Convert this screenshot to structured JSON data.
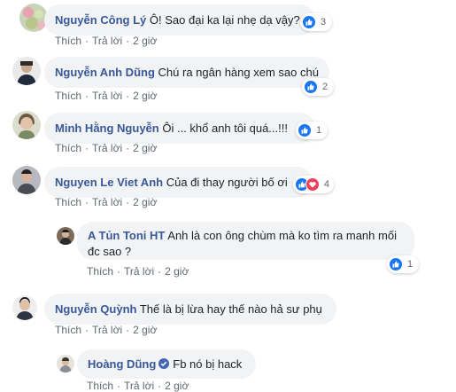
{
  "comments": [
    {
      "author": "Nguyễn Công Lý",
      "text": "Ô! Sao đại ka lại nhẹ dạ vậy?",
      "reactions": "3",
      "like": "Thích",
      "reply": "Trả lời",
      "time": "2 giờ"
    },
    {
      "author": "Nguyễn Anh Dũng",
      "text": "Chú ra ngân hàng xem sao chú",
      "reactions": "2",
      "like": "Thích",
      "reply": "Trả lời",
      "time": "2 giờ"
    },
    {
      "author": "Minh Hằng Nguyễn",
      "text": "Ôi ... khổ anh tôi quá...!!!",
      "reactions": "1",
      "like": "Thích",
      "reply": "Trả lời",
      "time": "2 giờ"
    },
    {
      "author": "Nguyen Le Viet Anh",
      "text": "Của đi thay người bố ơi",
      "reactions": "4",
      "like": "Thích",
      "reply": "Trả lời",
      "time": "2 giờ"
    },
    {
      "author": "A Tủn Toni HT",
      "text": "Anh là con ông chùm mà ko tìm ra manh mối đc sao ?",
      "reactions": "1",
      "like": "Thích",
      "reply": "Trả lời",
      "time": "2 giờ"
    },
    {
      "author": "Nguyễn Quỳnh",
      "text": "Thế là bị lừa hay thế nào hả sư phụ",
      "like": "Thích",
      "reply": "Trả lời",
      "time": "2 giờ"
    },
    {
      "author": "Hoàng Dũng",
      "text": "Fb nó bị hack",
      "like": "Thích",
      "reply": "Trả lời",
      "time": "2 giờ"
    }
  ],
  "colors": {
    "author": "#385898",
    "bubble": "#f2f3f5",
    "like": "#1877f2",
    "love": "#f33e58",
    "meta": "#606770"
  }
}
